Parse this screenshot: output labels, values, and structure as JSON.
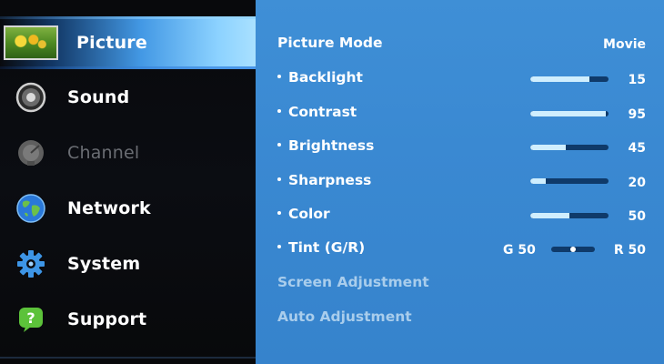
{
  "menu": {
    "items": [
      {
        "label": "Picture",
        "icon": "picture-thumbnail-icon",
        "selected": true,
        "enabled": true
      },
      {
        "label": "Sound",
        "icon": "speaker-icon",
        "selected": false,
        "enabled": true
      },
      {
        "label": "Channel",
        "icon": "satellite-dish-icon",
        "selected": false,
        "enabled": false
      },
      {
        "label": "Network",
        "icon": "globe-icon",
        "selected": false,
        "enabled": true
      },
      {
        "label": "System",
        "icon": "gear-icon",
        "selected": false,
        "enabled": true
      },
      {
        "label": "Support",
        "icon": "help-bubble-icon",
        "selected": false,
        "enabled": true
      }
    ]
  },
  "picture": {
    "mode": {
      "label": "Picture Mode",
      "value": "Movie"
    },
    "settings": [
      {
        "label": "Backlight",
        "value": "15",
        "level": 0.75
      },
      {
        "label": "Contrast",
        "value": "95",
        "level": 0.97
      },
      {
        "label": "Brightness",
        "value": "45",
        "level": 0.45
      },
      {
        "label": "Sharpness",
        "value": "20",
        "level": 0.2
      },
      {
        "label": "Color",
        "value": "50",
        "level": 0.5
      }
    ],
    "tint": {
      "label": "Tint (G/R)",
      "g_value": "G 50",
      "r_value": "R 50",
      "level": 0.5
    },
    "screen_adjustment": "Screen Adjustment",
    "auto_adjustment": "Auto Adjustment"
  },
  "colors": {
    "panel_blue": "#3a89d2",
    "slider_fill": "#cfeefe",
    "slider_track": "#0f3a6a",
    "highlight": "#7fc7f6"
  }
}
